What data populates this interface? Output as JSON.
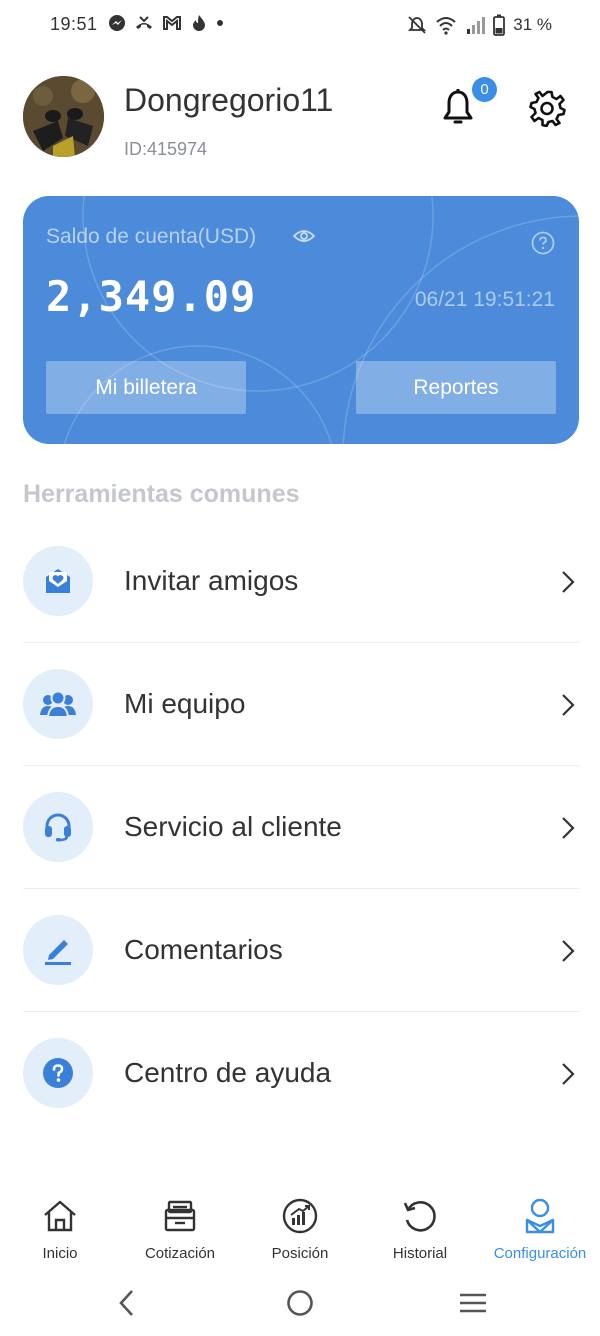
{
  "status_bar": {
    "time": "19:51",
    "battery_text": "31 %",
    "left_icons": [
      "messenger-icon",
      "missed-call-icon",
      "gmail-icon",
      "fire-icon",
      "dot-icon"
    ],
    "right_icons": [
      "mute-icon",
      "wifi-icon",
      "signal-icon",
      "battery-icon"
    ]
  },
  "profile": {
    "username": "Dongregorio11",
    "user_id": "ID:415974",
    "notification_count": "0"
  },
  "account_card": {
    "label": "Saldo de cuenta(USD)",
    "balance": "2,349.09",
    "timestamp": "06/21 19:51:21",
    "wallet_button": "Mi billetera",
    "reports_button": "Reportes",
    "color": "#4b8bd9"
  },
  "tools": {
    "section_title": "Herramientas comunes",
    "items": [
      {
        "label": "Invitar amigos",
        "icon": "invite-icon"
      },
      {
        "label": "Mi equipo",
        "icon": "team-icon"
      },
      {
        "label": "Servicio al cliente",
        "icon": "headset-icon"
      },
      {
        "label": "Comentarios",
        "icon": "pen-icon"
      },
      {
        "label": "Centro de ayuda",
        "icon": "help-icon"
      }
    ]
  },
  "bottom_nav": {
    "items": [
      {
        "label": "Inicio",
        "icon": "home-icon"
      },
      {
        "label": "Cotización",
        "icon": "quotes-icon"
      },
      {
        "label": "Posición",
        "icon": "position-icon"
      },
      {
        "label": "Historial",
        "icon": "history-icon"
      },
      {
        "label": "Configuración",
        "icon": "profile-icon",
        "active": true
      }
    ],
    "active_color": "#3a8ee6"
  }
}
